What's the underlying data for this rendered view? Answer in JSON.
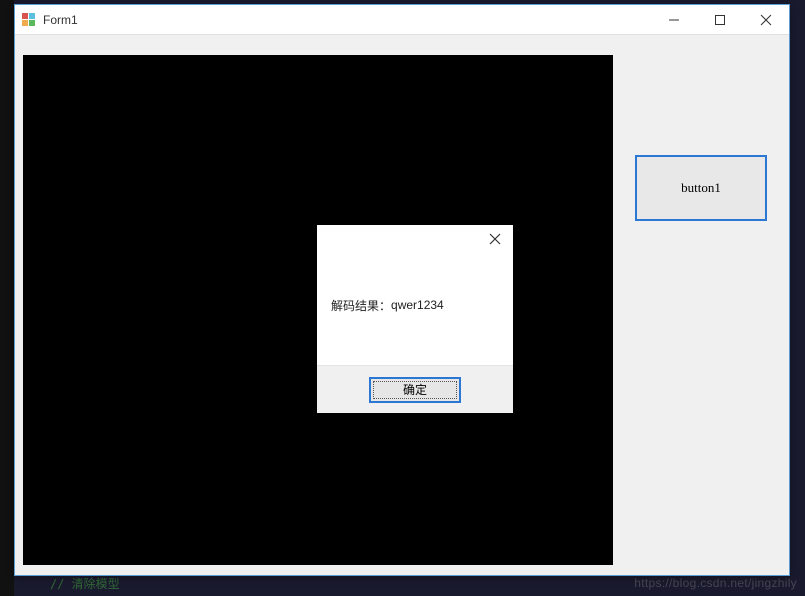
{
  "window": {
    "title": "Form1"
  },
  "controls": {
    "button1_label": "button1"
  },
  "dialog": {
    "message_prefix": "解码结果：",
    "message_value": "qwer1234",
    "ok_label": "确定"
  },
  "background": {
    "watermark": "https://blog.csdn.net/jingzhily",
    "bottom_snippet": "// 清除模型"
  }
}
